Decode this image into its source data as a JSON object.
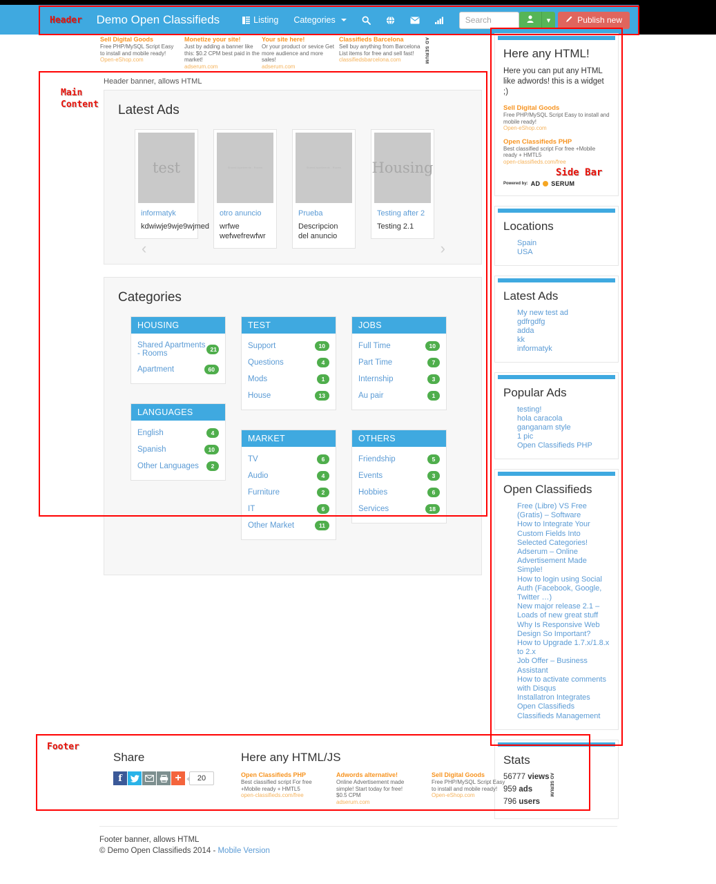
{
  "annotations": {
    "header": "Header",
    "main_content": "Main\nContent",
    "sidebar": "Side Bar",
    "footer": "Footer"
  },
  "header": {
    "brand": "Demo Open Classifieds",
    "nav": [
      {
        "label": "Listing",
        "icon": "list-icon"
      },
      {
        "label": "Categories",
        "icon": "chevron-down-icon"
      },
      {
        "label": "",
        "icon": "search-icon"
      },
      {
        "label": "",
        "icon": "globe-icon"
      },
      {
        "label": "",
        "icon": "envelope-icon"
      },
      {
        "label": "",
        "icon": "chart-bars-icon"
      }
    ],
    "search": {
      "placeholder": "Search",
      "value": ""
    },
    "user_button": {
      "icon": "user-icon",
      "caret": "▾"
    },
    "publish_button": {
      "label": "Publish new",
      "icon": "pencil-icon",
      "color": "#e0655d"
    }
  },
  "top_banner": {
    "ads": [
      {
        "title": "Sell Digital Goods",
        "body": "Free PHP/MySQL Script\nEasy to install and mobile ready!",
        "url": "Open-eShop.com"
      },
      {
        "title": "Monetize your site!",
        "body": "Just by adding a banner like this: $0.2 CPM best paid in the market!",
        "url": "adserum.com"
      },
      {
        "title": "Your site here!",
        "body": "Or your product or sevice Get more audience and more sales!",
        "url": "adserum.com"
      },
      {
        "title": "Classifieds Barcelona",
        "body": "Sell buy anything from Barcelona List items for free and sell fast!",
        "url": "classifiedsbarcelona.com"
      }
    ],
    "provider": "AD SERUM"
  },
  "main": {
    "header_banner_note": "Header banner, allows HTML",
    "latest_ads": {
      "title": "Latest Ads",
      "prev_arrow": "‹",
      "next_arrow": "›",
      "cards": [
        {
          "thumb_text": "test",
          "thumb_style": "big",
          "title": "informatyk",
          "desc": "kdwiwje9wje9wjmed"
        },
        {
          "thumb_text": "Shared Apartments - Rooms",
          "thumb_style": "tiny",
          "title": "otro anuncio",
          "desc": "wrfwe wefwefrewfwr"
        },
        {
          "thumb_text": "Shared Apartments - Rooms",
          "thumb_style": "tiny",
          "title": "Prueba",
          "desc": "Descripcion del anuncio"
        },
        {
          "thumb_text": "Housing",
          "thumb_style": "big",
          "title": "Testing after 2",
          "desc": "Testing 2.1"
        }
      ]
    },
    "categories": {
      "title": "Categories",
      "columns": [
        [
          {
            "name": "HOUSING",
            "items": [
              {
                "label": "Shared Apartments - Rooms",
                "count": "21"
              },
              {
                "label": "Apartment",
                "count": "60"
              }
            ]
          },
          {
            "name": "LANGUAGES",
            "items": [
              {
                "label": "English",
                "count": "4"
              },
              {
                "label": "Spanish",
                "count": "10"
              },
              {
                "label": "Other Languages",
                "count": "2"
              }
            ]
          }
        ],
        [
          {
            "name": "TEST",
            "items": [
              {
                "label": "Support",
                "count": "10"
              },
              {
                "label": "Questions",
                "count": "4"
              },
              {
                "label": "Mods",
                "count": "1"
              },
              {
                "label": "House",
                "count": "13"
              }
            ]
          },
          {
            "name": "MARKET",
            "items": [
              {
                "label": "TV",
                "count": "6"
              },
              {
                "label": "Audio",
                "count": "4"
              },
              {
                "label": "Furniture",
                "count": "2"
              },
              {
                "label": "IT",
                "count": "6"
              },
              {
                "label": "Other Market",
                "count": "11"
              }
            ]
          }
        ],
        [
          {
            "name": "JOBS",
            "items": [
              {
                "label": "Full Time",
                "count": "10"
              },
              {
                "label": "Part Time",
                "count": "7"
              },
              {
                "label": "Internship",
                "count": "3"
              },
              {
                "label": "Au pair",
                "count": "1"
              }
            ]
          },
          {
            "name": "OTHERS",
            "items": [
              {
                "label": "Friendship",
                "count": "5"
              },
              {
                "label": "Events",
                "count": "3"
              },
              {
                "label": "Hobbies",
                "count": "6"
              },
              {
                "label": "Services",
                "count": "18"
              }
            ]
          }
        ]
      ]
    }
  },
  "sidebar": {
    "html_widget": {
      "title": "Here any HTML!",
      "text": "Here you can put any HTML like adwords! this is a widget ;)",
      "ads": [
        {
          "title": "Sell Digital Goods",
          "body": "Free PHP/MySQL Script\nEasy to install and mobile ready!",
          "url": "Open-eShop.com"
        },
        {
          "title": "Open Classifieds PHP",
          "body": "Best classified script\nFor free +Mobile ready + HMTL5",
          "url": "open-classifieds.com/free"
        }
      ],
      "powered_by": "Powered by:",
      "provider": "AD SERUM"
    },
    "locations": {
      "title": "Locations",
      "items": [
        "Spain",
        "USA"
      ]
    },
    "latest_ads": {
      "title": "Latest Ads",
      "items": [
        "My new test ad",
        "gdfrgdfg",
        "adda",
        "kk",
        "informatyk"
      ]
    },
    "popular_ads": {
      "title": "Popular Ads",
      "items": [
        "testing!",
        "hola caracola",
        "ganganam style",
        "1 pic",
        "Open Classifieds PHP"
      ]
    },
    "blog": {
      "title": "Open Classifieds",
      "items": [
        "Free (Libre) VS Free (Gratis) – Software",
        "How to Integrate Your Custom Fields Into Selected Categories!",
        "Adserum – Online Advertisement Made Simple!",
        "How to login using Social Auth (Facebook, Google, Twitter …)",
        "New major release 2.1 – Loads of new great stuff",
        "Why Is Responsive Web Design So Important?",
        "How to Upgrade 1.7.x/1.8.x to 2.x",
        "Job Offer – Business Assistant",
        "How to activate comments with Disqus",
        "Installatron Integrates Open Classifieds Classifieds Management"
      ]
    },
    "stats": {
      "title": "Stats",
      "lines": [
        {
          "value": "56777",
          "label": "views"
        },
        {
          "value": "959",
          "label": "ads"
        },
        {
          "value": "796",
          "label": "users"
        }
      ]
    }
  },
  "footer": {
    "share": {
      "title": "Share",
      "count": "20",
      "icons": [
        "facebook-icon",
        "twitter-icon",
        "email-icon",
        "print-icon",
        "share-plus-icon"
      ]
    },
    "html_js": {
      "title": "Here any HTML/JS",
      "ads": [
        {
          "title": "Open Classifieds PHP",
          "body": "Best classified script\nFor free +Mobile ready + HMTL5",
          "url": "open-classifieds.com/free"
        },
        {
          "title": "Adwords alternative!",
          "body": "Online Advertisement made simple!\nStart today for free! $0.5 CPM",
          "url": "adserum.com"
        },
        {
          "title": "Sell Digital Goods",
          "body": "Free PHP/MySQL Script\nEasy to install and mobile ready!",
          "url": "Open-eShop.com"
        }
      ],
      "provider": "AD SERUM"
    },
    "banner_note": "Footer banner, allows HTML",
    "copyright": "© Demo Open Classifieds 2014 - ",
    "mobile_link": "Mobile Version"
  }
}
